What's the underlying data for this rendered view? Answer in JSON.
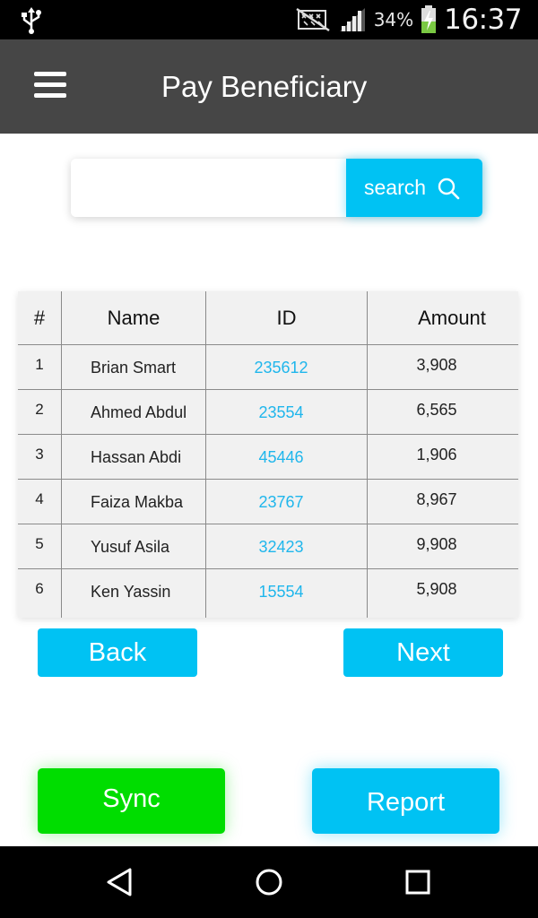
{
  "status_bar": {
    "battery_percent": "34%",
    "time": "16:37",
    "icons": [
      "usb-icon",
      "no-sim-icon",
      "signal-icon",
      "battery-charging-icon"
    ]
  },
  "app_bar": {
    "title": "Pay Beneficiary",
    "menu_icon": "hamburger-menu-icon"
  },
  "search": {
    "value": "",
    "placeholder": "",
    "button_label": "search",
    "icon": "search-icon"
  },
  "table": {
    "columns": [
      "#",
      "Name",
      "ID",
      "Amount"
    ],
    "rows": [
      {
        "num": "1",
        "name": "Brian Smart",
        "id": "235612",
        "amount": "3,908"
      },
      {
        "num": "2",
        "name": "Ahmed Abdul",
        "id": "23554",
        "amount": "6,565"
      },
      {
        "num": "3",
        "name": "Hassan Abdi",
        "id": "45446",
        "amount": "1,906"
      },
      {
        "num": "4",
        "name": "Faiza Makba",
        "id": "23767",
        "amount": "8,967"
      },
      {
        "num": "5",
        "name": "Yusuf Asila",
        "id": "32423",
        "amount": "9,908"
      },
      {
        "num": "6",
        "name": "Ken Yassin",
        "id": "15554",
        "amount": "5,908"
      }
    ]
  },
  "pagination": {
    "back_label": "Back",
    "next_label": "Next"
  },
  "actions": {
    "sync_label": "Sync",
    "report_label": "Report"
  },
  "colors": {
    "accent_blue": "#00c2f3",
    "sync_green": "#00dd00",
    "app_bar": "#464646",
    "id_link": "#1fb6ec"
  },
  "nav_bar": {
    "icons": [
      "back-triangle-icon",
      "home-circle-icon",
      "recents-square-icon"
    ]
  }
}
